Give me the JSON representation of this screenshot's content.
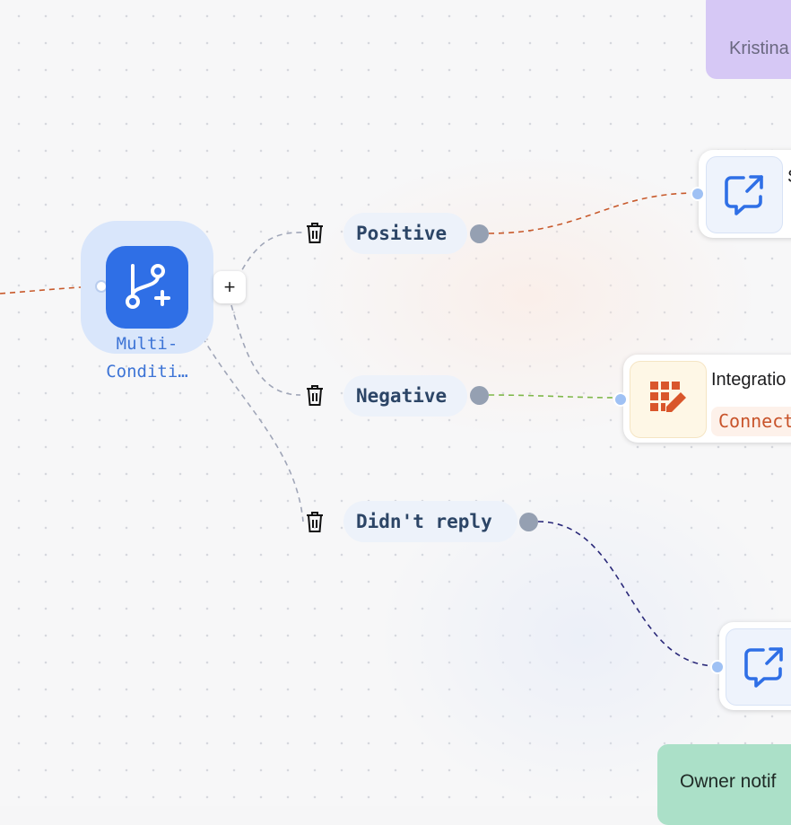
{
  "multi_condition": {
    "label_line1": "Multi-",
    "label_line2": "Conditi…",
    "add_symbol": "+"
  },
  "branches": [
    {
      "label": "Positive"
    },
    {
      "label": "Negative"
    },
    {
      "label": "Didn't reply"
    }
  ],
  "integration_node": {
    "title": "Integratio",
    "badge": "Connect"
  },
  "top_message_node": {
    "title": "S"
  },
  "notes": {
    "purple": "Kristina",
    "green": "Owner notif"
  },
  "colors": {
    "accent_blue": "#2f6fe6",
    "edge_orange": "#c85a2c",
    "edge_green": "#7fb84a",
    "edge_navy": "#2b2a7a",
    "edge_gray": "#a0a6b8"
  },
  "icons": [
    "branch-plus-icon",
    "trash-icon",
    "message-share-icon",
    "sheet-edit-icon"
  ]
}
